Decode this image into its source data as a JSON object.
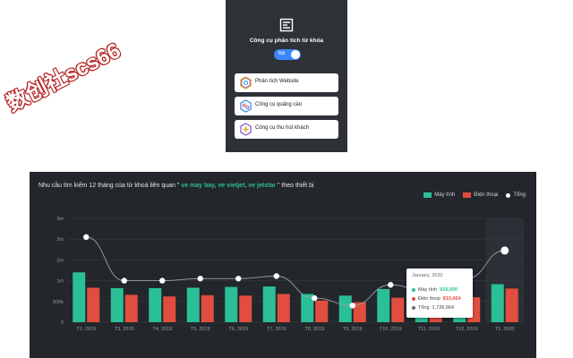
{
  "popup": {
    "title": "Công cụ phân tích từ khóa",
    "toggle_label": "Bật",
    "buttons": [
      {
        "label": "Phân tích Website",
        "icon": "hexagon-analytics-icon"
      },
      {
        "label": "Công cụ quảng cáo",
        "icon": "hexagon-ads-icon"
      },
      {
        "label": "Công cụ thu hút khách",
        "icon": "hexagon-plus-icon"
      }
    ]
  },
  "watermark": "数创社scs66",
  "chart": {
    "title_prefix": "Nhu cầu tìm kiếm 12 tháng của từ khoá liên quan \"",
    "title_keywords": " ve may bay, ve vietjet, ve jetstar ",
    "title_suffix": "\" theo thiết bị",
    "legend": [
      "Máy tính",
      "Điện thoại",
      "Tổng"
    ],
    "tooltip": {
      "header": "January, 2020",
      "rows": [
        {
          "label": "Máy tính",
          "value": "916,000",
          "color": "#2bbf97"
        },
        {
          "label": "Điện thoại",
          "value": "810,664",
          "color": "#e14d3f"
        },
        {
          "label": "Tổng",
          "value": "1,726,664",
          "color": "#6b7078"
        }
      ]
    }
  },
  "colors": {
    "desktop": "#2bbf97",
    "mobile": "#e14d3f",
    "total": "#ffffff",
    "panel": "#23262b"
  },
  "chart_data": {
    "type": "bar",
    "categories": [
      "T2, 2019",
      "T3, 2019",
      "T4, 2019",
      "T5, 2019",
      "T6, 2019",
      "T7, 2019",
      "T8, 2019",
      "T9, 2019",
      "T10, 2019",
      "T11, 2019",
      "T12, 2019",
      "T1, 2020"
    ],
    "series": [
      {
        "name": "Máy tính",
        "values": [
          1200000,
          820000,
          820000,
          830000,
          850000,
          860000,
          680000,
          640000,
          800000,
          560000,
          820000,
          916000
        ]
      },
      {
        "name": "Điện thoại",
        "values": [
          830000,
          660000,
          620000,
          650000,
          640000,
          680000,
          520000,
          480000,
          590000,
          460000,
          600000,
          810664
        ]
      },
      {
        "name": "Tổng",
        "type": "line",
        "values": [
          2050000,
          1000000,
          1000000,
          1050000,
          1050000,
          1110000,
          580000,
          400000,
          900000,
          720000,
          1050000,
          1726664
        ]
      }
    ],
    "yticks": [
      "0",
      "500k",
      "1m",
      "2m",
      "2m",
      "3m"
    ],
    "ylim": [
      0,
      2500000
    ],
    "grid": true,
    "legend_position": "top-right"
  }
}
